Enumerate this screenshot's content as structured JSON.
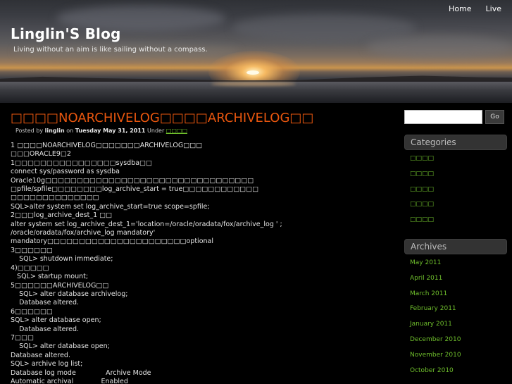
{
  "nav": {
    "home": "Home",
    "live": "Live"
  },
  "site": {
    "title": "Linglin'S Blog",
    "tagline": "Living without an aim is like sailing without a compass."
  },
  "post": {
    "title": "□□□□NOARCHIVELOG□□□□ARCHIVELOG□□",
    "meta": {
      "posted_by": "Posted by",
      "author": "linglin",
      "on": "on",
      "date": "Tuesday May 31, 2011",
      "under": "Under",
      "category": "□□□□"
    },
    "lines": [
      "1 □□□□NOARCHIVELOG□□□□□□□ARCHIVELOG□□□",
      "□□□ORACLE9□2",
      "1□□□□□□□□□□□□□□□□sysdba□□",
      "connect sys/password as sysdba",
      "Oracle10g□□□□□□□□□□□□□□□□□□□□□□□□□□□□□□□□□",
      "□pfile/spfile□□□□□□□□log_archive_start = true□□□□□□□□□□□□",
      "□□□□□□□□□□□□□□",
      "SQL>alter system set log_archive_start=true scope=spfile;",
      "2□□□log_archive_dest_1 □□",
      "alter system set log_archive_dest_1='location=/oracle/oradata/fox/archive_log ' ;",
      "/oracle/oradata/fox/archive_log mandatory'",
      "mandatory□□□□□□□□□□□□□□□□□□□□□□optional",
      "3□□□□□□",
      "    SQL> shutdown immediate;",
      "4)□□□□□",
      "   SQL> startup mount;",
      "5□□□□□□ARCHIVELOG□□",
      "    SQL> alter database archivelog;",
      "    Database altered.",
      "6□□□□□□",
      "SQL> alter database open;",
      "    Database altered.",
      "7□□□",
      "    SQL> alter database open;",
      "Database altered.",
      "SQL> archive log list;",
      "Database log mode              Archive Mode",
      "Automatic archival             Enabled"
    ]
  },
  "sidebar": {
    "search": {
      "value": "",
      "placeholder": "",
      "button": "Go"
    },
    "categories_title": "Categories",
    "categories": [
      "□□□□",
      "□□□□",
      "□□□□",
      "□□□□",
      "□□□□"
    ],
    "archives_title": "Archives",
    "archives": [
      "May 2011",
      "April 2011",
      "March 2011",
      "February 2011",
      "January 2011",
      "December 2010",
      "November 2010",
      "October 2010"
    ]
  }
}
